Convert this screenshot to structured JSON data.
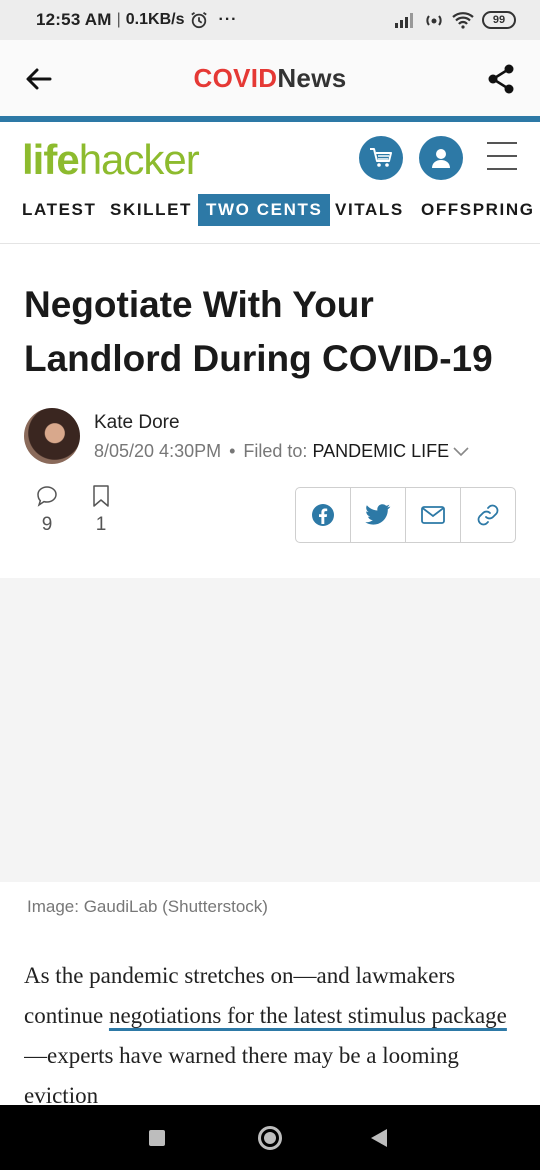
{
  "status_bar": {
    "time": "12:53 AM",
    "separator": "|",
    "speed": "0.1KB/s",
    "more": "···",
    "battery": "99"
  },
  "app_bar": {
    "title_red": "COVID",
    "title_dark": "News"
  },
  "site": {
    "logo_bold": "life",
    "logo_thin": "hacker",
    "nav": [
      {
        "label": "LATEST"
      },
      {
        "label": "SKILLET"
      },
      {
        "label": "TWO CENTS",
        "active": true
      },
      {
        "label": "VITALS"
      },
      {
        "label": "OFFSPRING"
      }
    ]
  },
  "article": {
    "headline": "Negotiate With Your Landlord During COVID-19",
    "author": "Kate Dore",
    "date": "8/05/20 4:30PM",
    "dot": "•",
    "filed_label": "Filed to: ",
    "category": "PANDEMIC LIFE",
    "comments_count": "9",
    "bookmarks_count": "1",
    "image_caption": "Image: GaudiLab (Shutterstock)",
    "body_before": "As the pandemic stretches on—and lawmakers continue ",
    "body_link": "negotiations for the latest stimulus package",
    "body_after": "—experts have warned there may be a looming eviction"
  },
  "colors": {
    "accent": "#2d79a6",
    "covid_red": "#e53935",
    "logo_green": "#8dbb2e"
  }
}
